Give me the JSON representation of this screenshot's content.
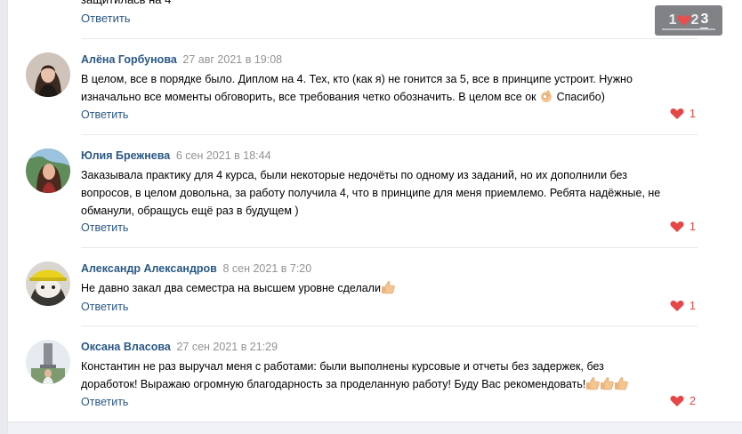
{
  "top_partial": {
    "text_fragment": "защитилась на 4",
    "reply_label": "Ответить"
  },
  "paginator": {
    "pages": [
      "1",
      "2",
      "3"
    ],
    "active": "3"
  },
  "comments": [
    {
      "author": "Алёна Горбунова",
      "date": "27 авг 2021 в 19:08",
      "lines": [
        "В целом, все в порядке было. Диплом на 4. Тех, кто (как я) не гонится за 5, все в принципе устроит. Нужно",
        "изначально все моменты обговорить, все требования четко обозначить. В целом все ок",
        "Спасибо)"
      ],
      "reply_label": "Ответить",
      "likes": "1",
      "emoji": "ok-hand-icon"
    },
    {
      "author": "Юлия Брежнева",
      "date": "6 сен 2021 в 18:44",
      "lines": [
        "Заказывала практику для 4 курса, были некоторые недочёты по одному из заданий, но их дополнили без",
        "вопросов, в целом довольна, за работу получила 4, что в принципе для меня приемлемо. Ребята надёжные, не",
        "обманули, обращусь ещё раз в будущем )"
      ],
      "reply_label": "Ответить",
      "likes": "1"
    },
    {
      "author": "Александр Александров",
      "date": "8 сен 2021 в 7:20",
      "lines": [
        "Не давно закал два семестра на высшем уровне сделали"
      ],
      "reply_label": "Ответить",
      "likes": "1",
      "emoji": "thumbs-up-icon"
    },
    {
      "author": "Оксана Власова",
      "date": "27 сен 2021 в 21:29",
      "lines": [
        "Константин не раз выручал меня с работами: были выполнены курсовые и отчеты без задержек, без",
        "доработок! Выражаю огромную благодарность за проделанную работу! Буду Вас рекомендовать!"
      ],
      "reply_label": "Ответить",
      "likes": "2",
      "emoji": "thumbs-up-icon"
    }
  ],
  "colors": {
    "link": "#2a5885",
    "date": "#939393",
    "like": "#e64646",
    "divider": "#e7e8ec"
  }
}
